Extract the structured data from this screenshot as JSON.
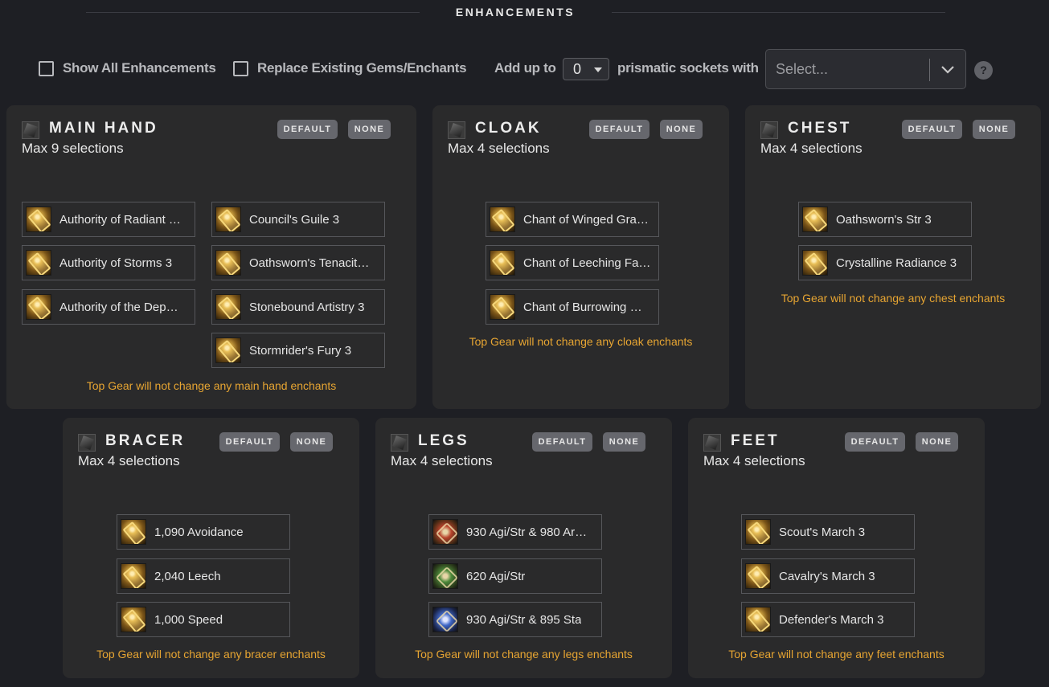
{
  "section": {
    "title": "ENHANCEMENTS"
  },
  "options": {
    "show_all_label": "Show All Enhancements",
    "replace_label": "Replace Existing Gems/Enchants",
    "add_up_to_label": "Add up to",
    "sockets_value": "0",
    "prismatic_label": "prismatic sockets with",
    "select_placeholder": "Select...",
    "help_label": "?"
  },
  "buttons": {
    "default_label": "DEFAULT",
    "none_label": "NONE"
  },
  "cards": {
    "main_hand": {
      "title": "MAIN HAND",
      "subtitle": "Max 9 selections",
      "items": [
        {
          "label": "Authority of Radiant …",
          "icon": "scroll"
        },
        {
          "label": "Authority of Storms 3",
          "icon": "scroll"
        },
        {
          "label": "Authority of the Dep…",
          "icon": "scroll"
        },
        {
          "label": "Council's Guile 3",
          "icon": "scroll"
        },
        {
          "label": "Oathsworn's Tenacit…",
          "icon": "scroll"
        },
        {
          "label": "Stonebound Artistry 3",
          "icon": "scroll"
        },
        {
          "label": "Stormrider's Fury 3",
          "icon": "scroll"
        }
      ],
      "note": "Top Gear will not change any main hand enchants"
    },
    "cloak": {
      "title": "CLOAK",
      "subtitle": "Max 4 selections",
      "items": [
        {
          "label": "Chant of Winged Gra…",
          "icon": "scroll"
        },
        {
          "label": "Chant of Leeching Fa…",
          "icon": "scroll"
        },
        {
          "label": "Chant of Burrowing …",
          "icon": "scroll"
        }
      ],
      "note": "Top Gear will not change any cloak enchants"
    },
    "chest": {
      "title": "CHEST",
      "subtitle": "Max 4 selections",
      "items": [
        {
          "label": "Oathsworn's Str 3",
          "icon": "scroll"
        },
        {
          "label": "Crystalline Radiance 3",
          "icon": "scroll"
        }
      ],
      "note": "Top Gear will not change any chest enchants"
    },
    "bracer": {
      "title": "BRACER",
      "subtitle": "Max 4 selections",
      "items": [
        {
          "label": "1,090 Avoidance",
          "icon": "scroll"
        },
        {
          "label": "2,040 Leech",
          "icon": "scroll"
        },
        {
          "label": "1,000 Speed",
          "icon": "scroll"
        }
      ],
      "note": "Top Gear will not change any bracer enchants"
    },
    "legs": {
      "title": "LEGS",
      "subtitle": "Max 4 selections",
      "items": [
        {
          "label": "930 Agi/Str & 980 Ar…",
          "icon": "armor-kit-red"
        },
        {
          "label": "620 Agi/Str",
          "icon": "armor-kit-green"
        },
        {
          "label": "930 Agi/Str & 895 Sta",
          "icon": "armor-kit-blue"
        }
      ],
      "note": "Top Gear will not change any legs enchants"
    },
    "feet": {
      "title": "FEET",
      "subtitle": "Max 4 selections",
      "items": [
        {
          "label": "Scout's March 3",
          "icon": "scroll"
        },
        {
          "label": "Cavalry's March 3",
          "icon": "scroll"
        },
        {
          "label": "Defender's March 3",
          "icon": "scroll"
        }
      ],
      "note": "Top Gear will not change any feet enchants"
    }
  }
}
